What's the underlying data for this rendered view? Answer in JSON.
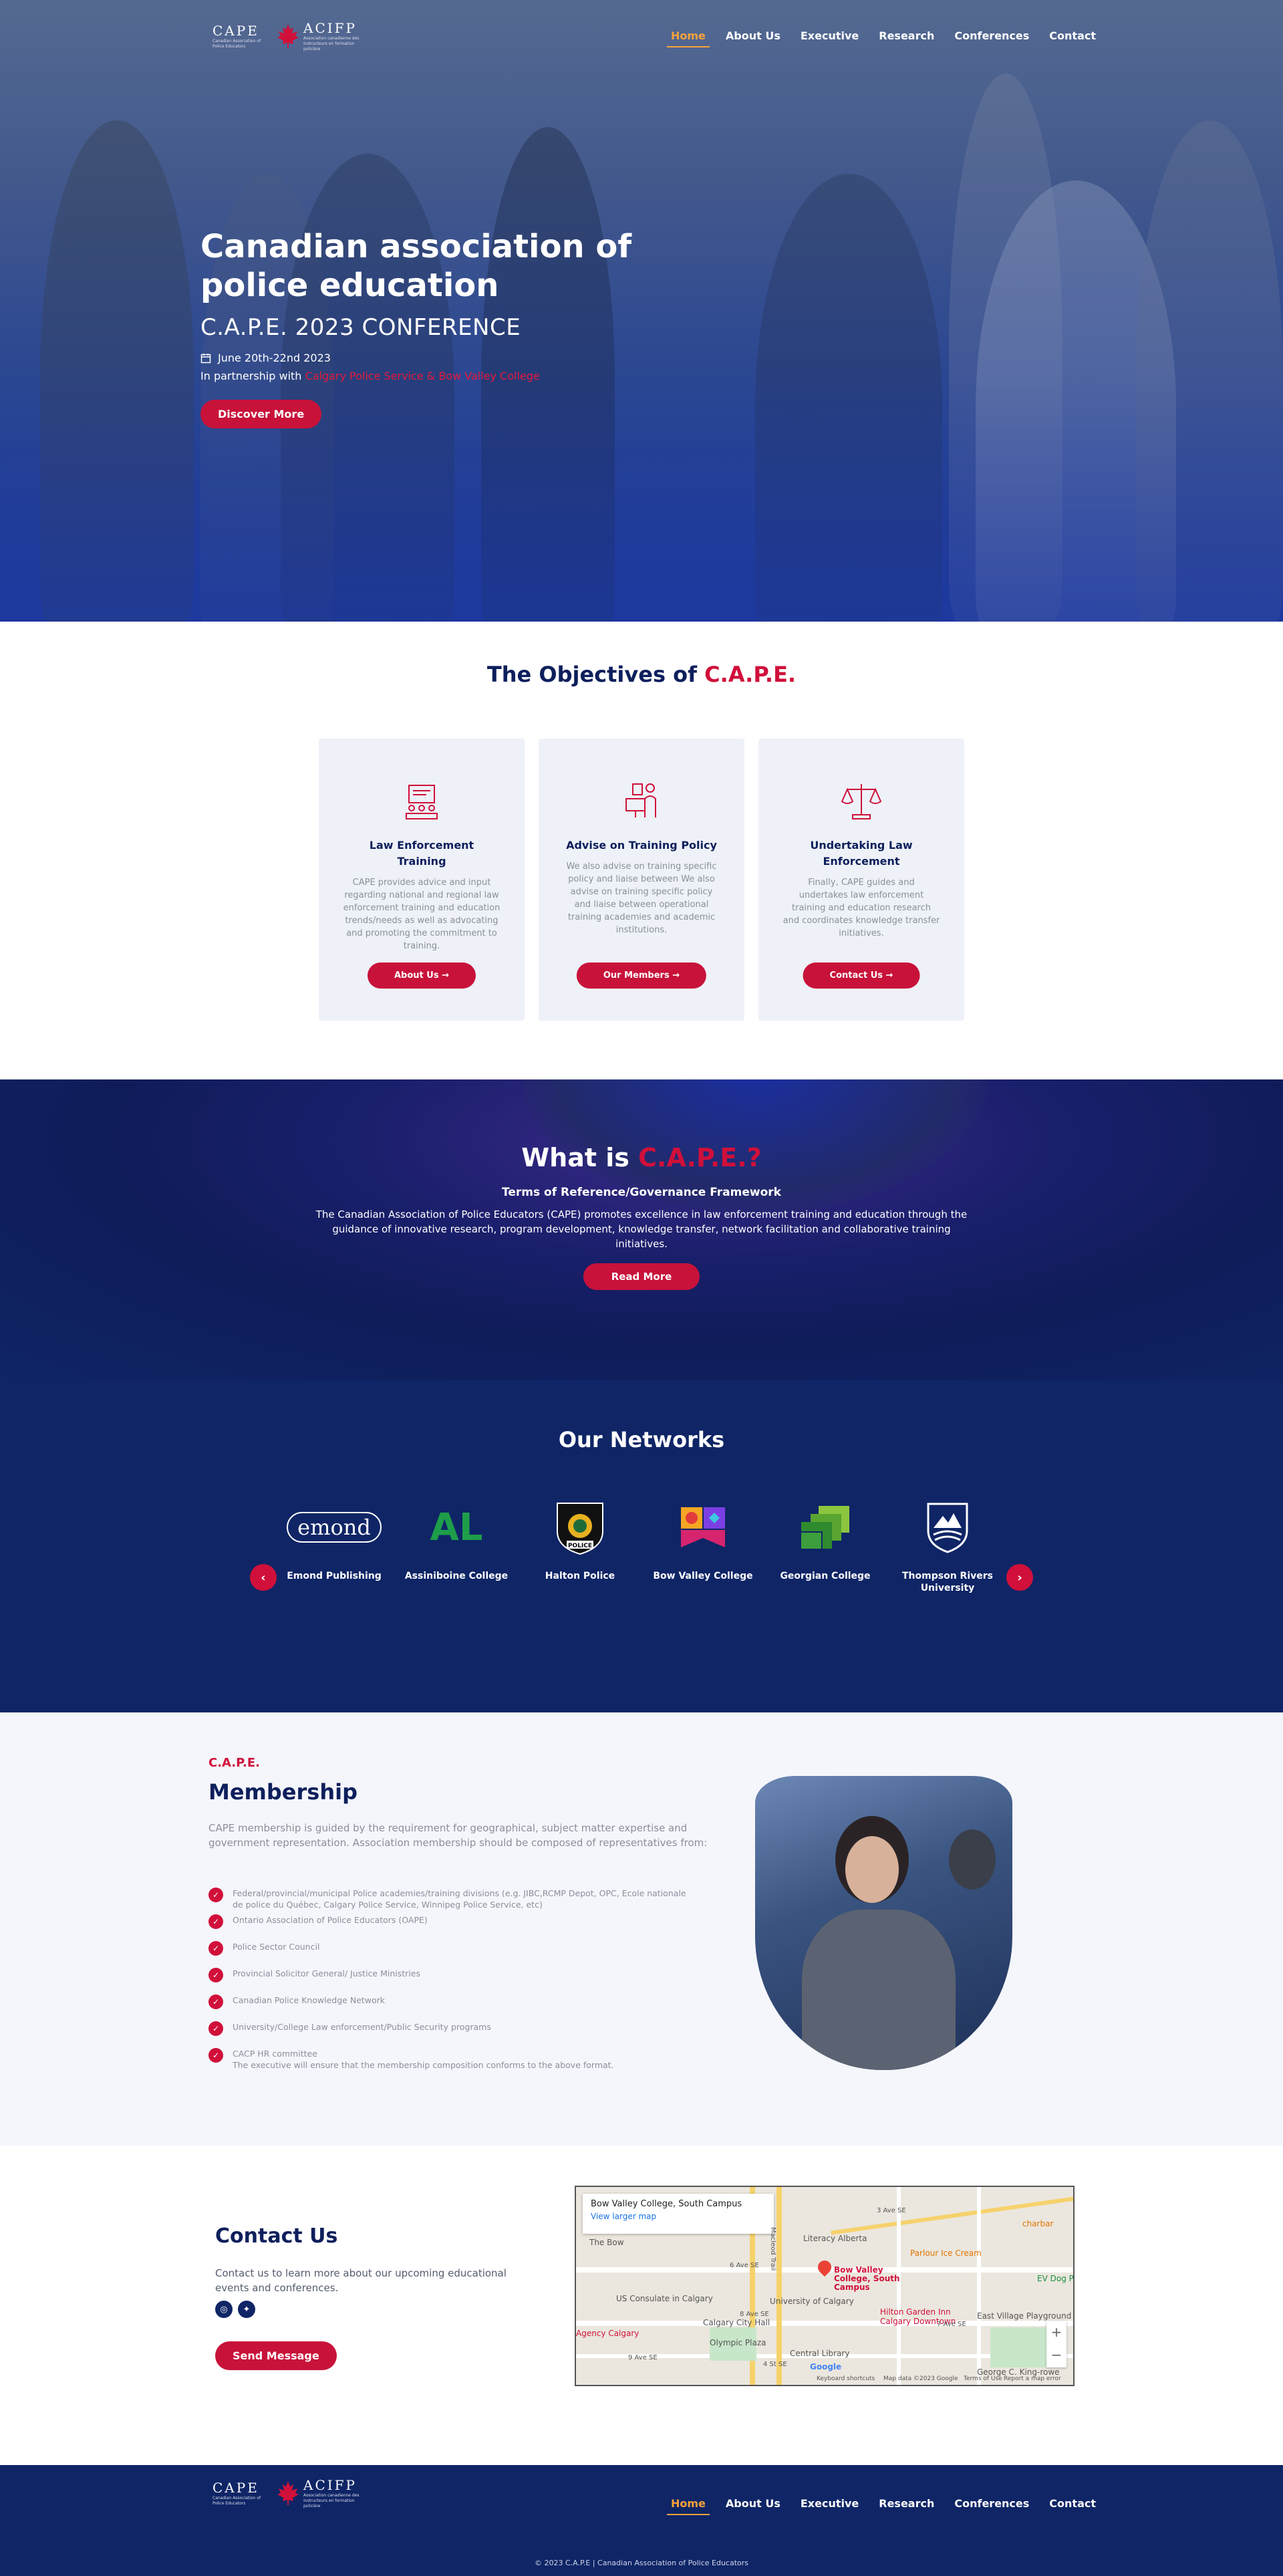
{
  "colors": {
    "brand_navy": "#0f2566",
    "accent_red": "#d0103a",
    "nav_active": "#f7a23b"
  },
  "brand": {
    "left_word": "CAPE",
    "right_word": "ACIFP",
    "left_sub": "Canadian Association of Police Educators",
    "right_sub": "Association canadienne des instructeurs en formation policière"
  },
  "nav": {
    "items": [
      "Home",
      "About Us",
      "Executive",
      "Research",
      "Conferences",
      "Contact"
    ],
    "active": "Home"
  },
  "hero": {
    "title": "Canadian association of police education",
    "subtitle": "C.A.P.E. 2023 CONFERENCE",
    "date": "June 20th-22nd 2023",
    "partner_prefix": "In partnership with",
    "partner_names": "Calgary Police Service & Bow Valley College",
    "cta": "Discover More"
  },
  "objectives": {
    "title_prefix": "The Objectives of",
    "title_highlight": "C.A.P.E.",
    "cards": [
      {
        "icon": "training-icon",
        "title": "Law Enforcement Training",
        "text": "CAPE provides advice and input regarding national and regional law enforcement training and education trends/needs as well as advocating and promoting the commitment to training.",
        "button": "About Us"
      },
      {
        "icon": "policy-icon",
        "title": "Advise on Training Policy",
        "text": "We also advise on training specific policy and liaise between We also advise on training specific policy and liaise between operational training academies and academic institutions.",
        "button": "Our Members"
      },
      {
        "icon": "scales-icon",
        "title": "Undertaking Law Enforcement",
        "text": "Finally, CAPE guides and undertakes law enforcement training and education research and coordinates knowledge transfer initiatives.",
        "button": "Contact Us"
      }
    ]
  },
  "whatis": {
    "title_prefix": "What is",
    "title_highlight": "C.A.P.E.?",
    "subheading": "Terms of Reference/Governance Framework",
    "text": "The Canadian Association of Police Educators (CAPE) promotes excellence in law enforcement training and education through the guidance of innovative research, program development, knowledge transfer, network facilitation and collaborative training initiatives.",
    "button": "Read More"
  },
  "networks": {
    "title": "Our Networks",
    "items": [
      {
        "name": "Emond Publishing",
        "logo_text": "emond"
      },
      {
        "name": "Assiniboine College",
        "logo_text": "AL"
      },
      {
        "name": "Halton Police",
        "logo_text": "POLICE"
      },
      {
        "name": "Bow Valley College",
        "logo_text": ""
      },
      {
        "name": "Georgian College",
        "logo_text": ""
      },
      {
        "name": "Thompson Rivers University",
        "logo_text": ""
      }
    ]
  },
  "membership": {
    "kicker": "C.A.P.E.",
    "title": "Membership",
    "intro": "CAPE membership is guided by the requirement for geographical, subject matter expertise and government representation. Association membership should be composed of representatives from:",
    "items": [
      "Federal/provincial/municipal Police academies/training divisions (e.g. JIBC,RCMP Depot, OPC, Ecole nationale de police du Québec, Calgary Police Service, Winnipeg Police Service, etc)",
      "Ontario Association of Police Educators (OAPE)",
      "Police Sector Council",
      "Provincial Solicitor General/ Justice Ministries",
      "Canadian Police Knowledge Network",
      "University/College Law enforcement/Public Security programs",
      "CACP HR committee",
      "The executive will ensure that the membership composition conforms to the above format."
    ]
  },
  "contact": {
    "title": "Contact Us",
    "text": "Contact us to learn more about our upcoming educational events and conferences.",
    "button": "Send Message"
  },
  "map": {
    "place": "Bow Valley College, South Campus",
    "link": "View larger map",
    "pin_label": "Bow Valley College, South Campus",
    "labels": [
      "Literacy Alberta",
      "Parlour Ice Cream",
      "charbar",
      "The Bow",
      "US Consulate in Calgary",
      "University of Calgary",
      "Hilton Garden Inn Calgary Downtown",
      "Calgary City Hall",
      "Olympic Plaza",
      "Central Library",
      "Agency Calgary",
      "East Village Playground",
      "EV Dog Park",
      "George C. King-rowe",
      "Google",
      "Keyboard shortcuts",
      "Map data ©2023 Google",
      "Terms of Use",
      "Report a map error",
      "9 Ave SE",
      "8 Ave SE",
      "7 Ave SE",
      "6 Ave SE",
      "3 Ave SE",
      "Macleod Trail",
      "4 St SE"
    ]
  },
  "footer": {
    "copyright": "© 2023 C.A.P.E | Canadian Association of Police Educators"
  }
}
